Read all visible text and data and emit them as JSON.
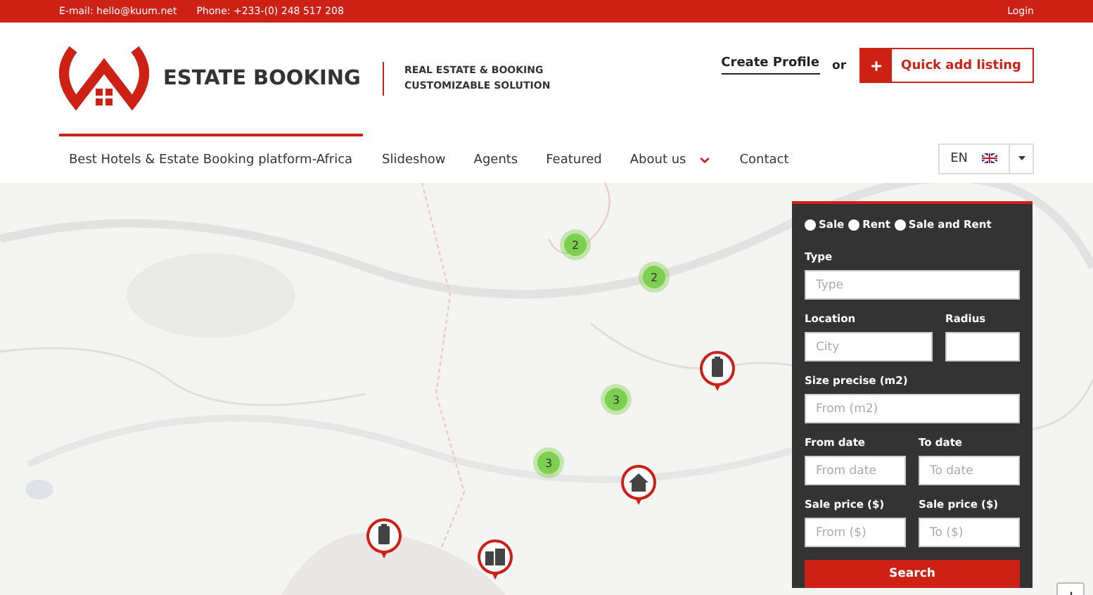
{
  "top_bar": {
    "email": "E-mail: hello@kuum.net",
    "phone": "Phone: +233-(0) 248 517 208",
    "login": "Login"
  },
  "header": {
    "brand": "ESTATE BOOKING",
    "tagline": [
      "REAL ESTATE & BOOKING",
      "CUSTOMIZABLE SOLUTION"
    ],
    "create_profile": "Create Profile",
    "or": "or",
    "add_button": "Quick add listing"
  },
  "nav": {
    "items": [
      {
        "label": "Best Hotels & Estate Booking platform-Africa",
        "selected": true,
        "has_menu": false
      },
      {
        "label": "Slideshow",
        "selected": false,
        "has_menu": false
      },
      {
        "label": "Agents",
        "selected": false,
        "has_menu": false
      },
      {
        "label": "Featured",
        "selected": false,
        "has_menu": false
      },
      {
        "label": "About us",
        "selected": false,
        "has_menu": true
      },
      {
        "label": "Contact",
        "selected": false,
        "has_menu": false
      }
    ],
    "language": "EN"
  },
  "map": {
    "kind": "picture",
    "markers": [
      {
        "kind": "cluster",
        "count": "2"
      },
      {
        "kind": "cluster",
        "count": "2"
      },
      {
        "kind": "tower"
      },
      {
        "kind": "cluster",
        "count": "3"
      },
      {
        "kind": "cluster",
        "count": "3"
      },
      {
        "kind": "house"
      },
      {
        "kind": "tower"
      },
      {
        "kind": "apartments"
      }
    ]
  },
  "search_form": {
    "listing_types": [
      {
        "label": "Sale",
        "selected": false
      },
      {
        "label": "Rent",
        "selected": false
      },
      {
        "label": "Sale and Rent",
        "selected": false
      }
    ],
    "rows": [
      [
        {
          "label": "Type",
          "placeholder": "Type"
        }
      ],
      [
        {
          "label": "Location",
          "placeholder": "City"
        },
        {
          "label": "Radius"
        }
      ],
      [
        {
          "label": "Size precise (m2)",
          "placeholder": "From (m2)"
        }
      ],
      [
        {
          "label": "From date",
          "placeholder": "From date"
        },
        {
          "label": "To date",
          "placeholder": "To date"
        }
      ],
      [
        {
          "label": "Sale price ($)",
          "placeholder": "From ($)"
        },
        {
          "label": "Sale price ($)",
          "placeholder": "To ($)"
        }
      ]
    ],
    "search_button": "Search"
  }
}
